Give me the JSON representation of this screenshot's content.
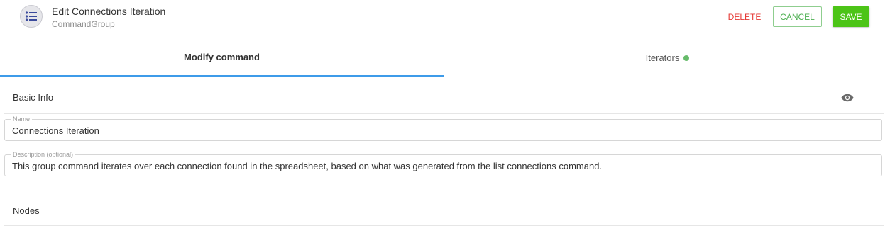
{
  "header": {
    "icon": "list-icon",
    "title": "Edit Connections Iteration",
    "subtitle": "CommandGroup",
    "delete_label": "DELETE",
    "cancel_label": "CANCEL",
    "save_label": "SAVE"
  },
  "tabs": [
    {
      "label": "Modify command",
      "active": true
    },
    {
      "label": "Iterators",
      "status_dot": "green"
    }
  ],
  "basic_info": {
    "heading": "Basic Info",
    "toggle_icon": "eye-icon",
    "name": {
      "label": "Name",
      "value": "Connections Iteration"
    },
    "description": {
      "label": "Description (optional)",
      "value": "This group command iterates over each connection found in the spreadsheet, based on what was generated from the list connections command."
    }
  },
  "nodes": {
    "heading": "Nodes"
  },
  "colors": {
    "delete": "#e53935",
    "cancel": "#4caf50",
    "save": "#4cc417",
    "active_tab_underline": "#3d9be9",
    "status_dot": "#66bb6a"
  }
}
